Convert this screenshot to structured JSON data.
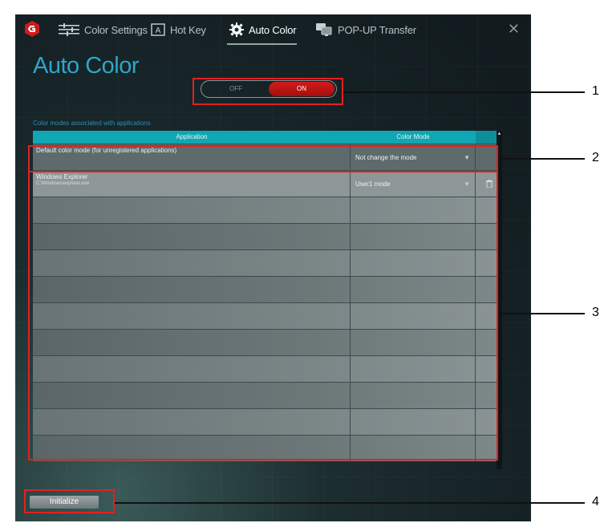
{
  "tabs": [
    {
      "label": "Color Settings",
      "icon": "sliders-icon",
      "active": false
    },
    {
      "label": "Hot Key",
      "icon": "keyboard-a-icon",
      "active": false
    },
    {
      "label": "Auto Color",
      "icon": "gear-icon",
      "active": true
    },
    {
      "label": "POP-UP Transfer",
      "icon": "monitors-icon",
      "active": false
    }
  ],
  "page_title": "Auto Color",
  "toggle": {
    "off_label": "OFF",
    "on_label": "ON",
    "state": "on"
  },
  "assoc_label": "Color modes associated with applications",
  "table": {
    "headers": [
      "Application",
      "Color Mode"
    ],
    "default_row": {
      "app": "Default color mode (for unregistered applications)",
      "mode": "Not change the mode"
    },
    "rows": [
      {
        "app": "Windows Explorer",
        "path": "C:\\Windows\\explorer.exe",
        "mode": "User1 mode"
      }
    ],
    "empty_rows": 10
  },
  "initialize_label": "Initialize",
  "callouts": [
    "1",
    "2",
    "3",
    "4"
  ],
  "colors": {
    "accent": "#2ea6c8",
    "header": "#10a6b3",
    "on": "#d11b1b",
    "callout": "#e32020"
  }
}
